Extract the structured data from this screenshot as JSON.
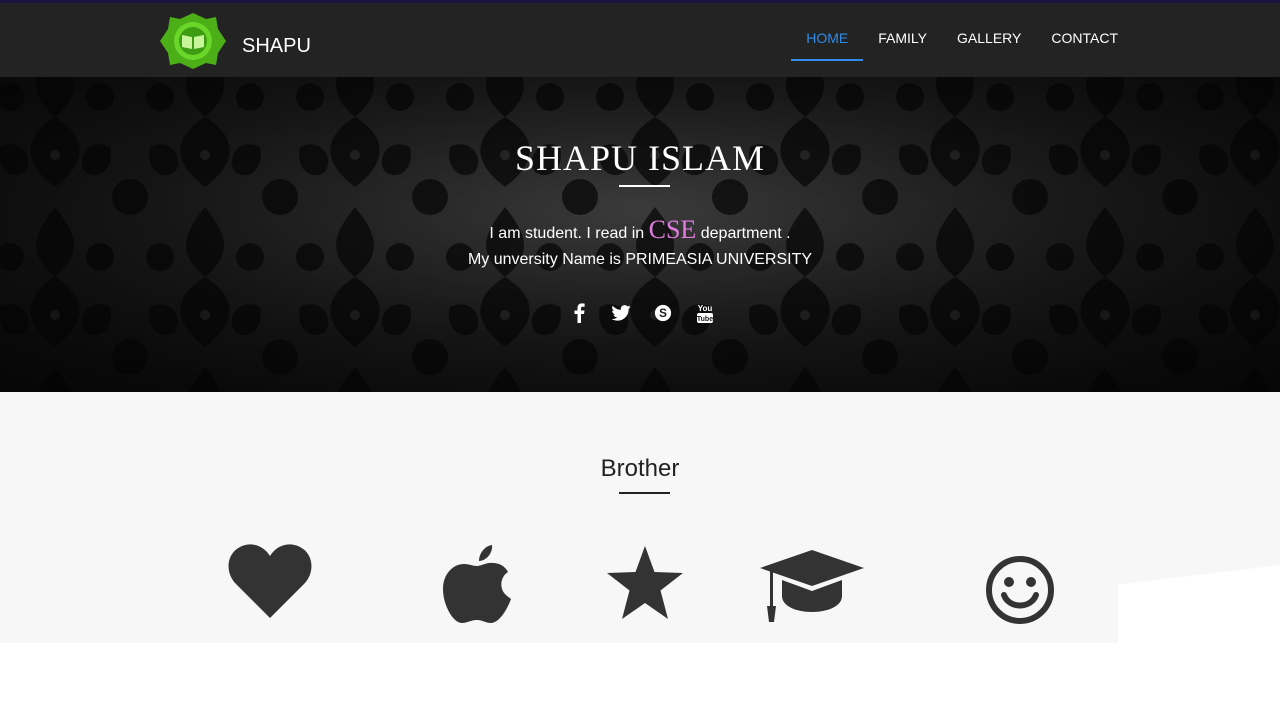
{
  "navbar": {
    "brand": "SHAPU",
    "items": [
      {
        "label": "HOME",
        "active": true
      },
      {
        "label": "FAMILY",
        "active": false
      },
      {
        "label": "GALLERY",
        "active": false
      },
      {
        "label": "CONTACT",
        "active": false
      }
    ]
  },
  "hero": {
    "title": "SHAPU ISLAM",
    "line1_prefix": "I am student. I read in ",
    "line1_highlight": "CSE",
    "line1_suffix": " department .",
    "line2": "My unversity Name is PRIMEASIA UNIVERSITY",
    "social": [
      "facebook-icon",
      "twitter-icon",
      "skype-icon",
      "youtube-icon"
    ]
  },
  "section": {
    "title": "Brother",
    "features": [
      "heart-icon",
      "apple-icon",
      "star-icon",
      "graduation-cap-icon",
      "smiley-icon"
    ]
  },
  "colors": {
    "nav_bg": "#232323",
    "accent": "#2f8ce8",
    "highlight": "#e07ce0",
    "section_bg": "#f7f7f7",
    "icon": "#333333"
  }
}
